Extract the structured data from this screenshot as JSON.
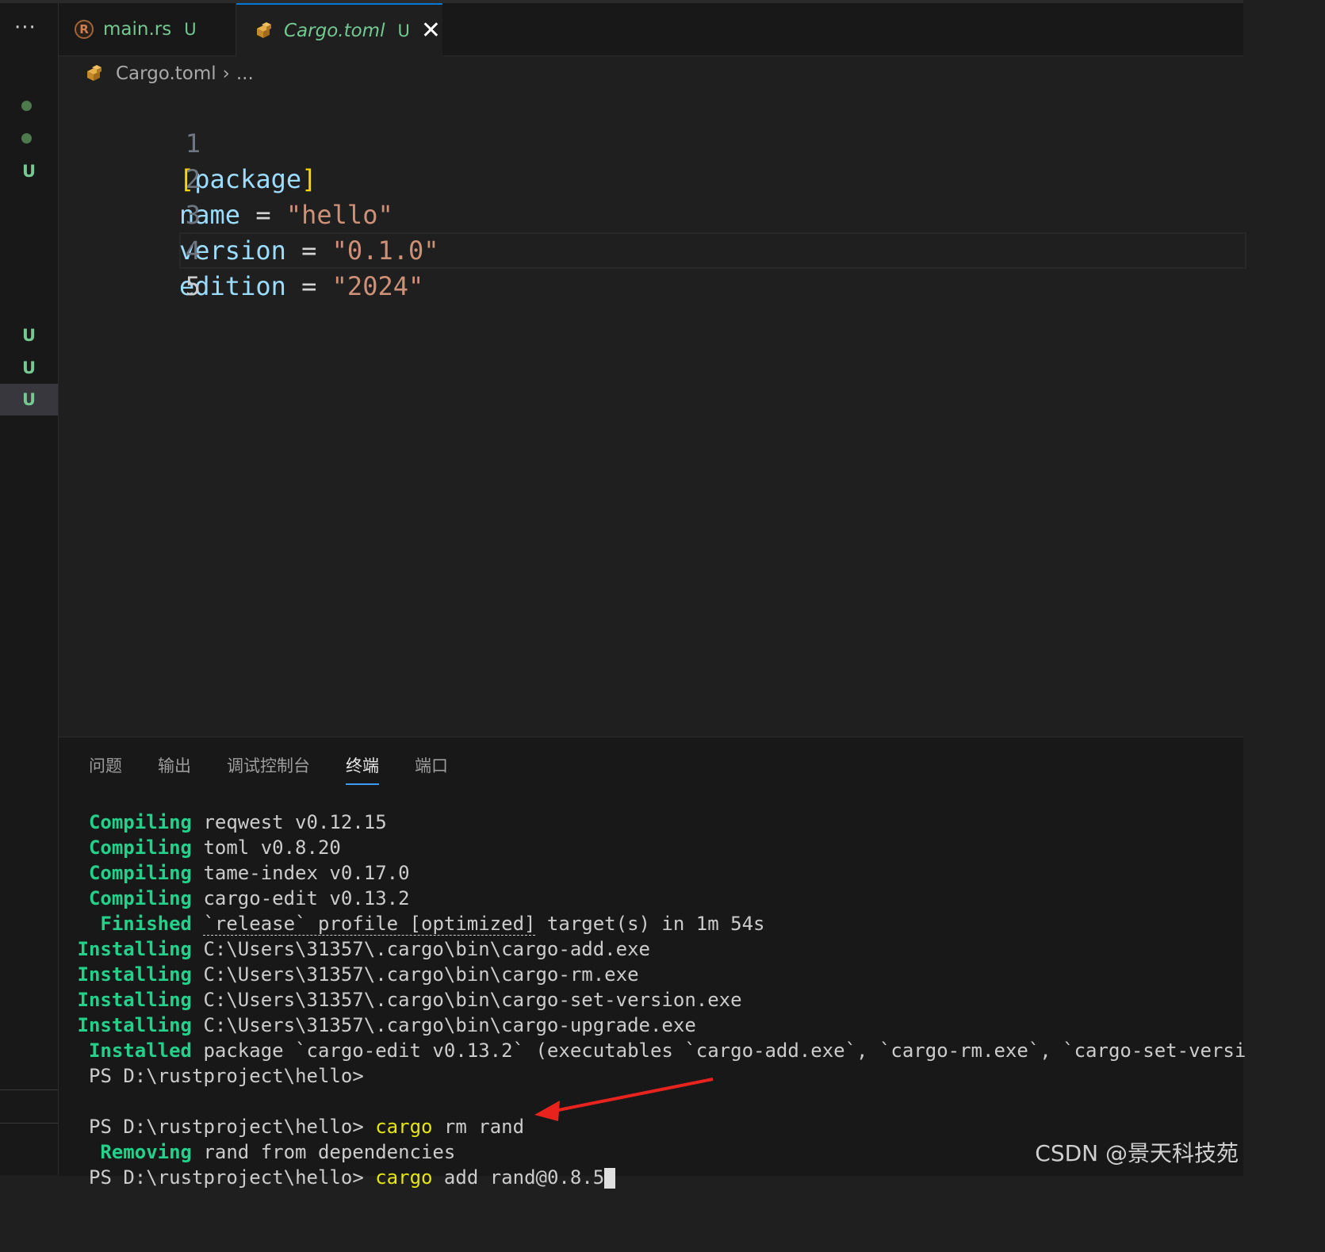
{
  "gutter": {
    "more": "···",
    "badges": [
      "U",
      "U",
      "U",
      "U"
    ]
  },
  "tabs": [
    {
      "label": "main.rs",
      "badge": "U",
      "icon": "rust-file-icon"
    },
    {
      "label": "Cargo.toml",
      "badge": "U",
      "icon": "cargo-package-icon",
      "close": "✕"
    }
  ],
  "breadcrumb": {
    "file": "Cargo.toml",
    "sep": "›",
    "rest": "..."
  },
  "editor": {
    "line_numbers": [
      "1",
      "2",
      "3",
      "4",
      "5"
    ],
    "lines": [
      {
        "open": "[",
        "key": "package",
        "close": "]"
      },
      {
        "key": "name",
        "eq": " = ",
        "value": "\"hello\""
      },
      {
        "key": "version",
        "eq": " = ",
        "value": "\"0.1.0\""
      },
      {
        "key": "edition",
        "eq": " = ",
        "value": "\"2024\""
      }
    ]
  },
  "panel": {
    "tabs": [
      "问题",
      "输出",
      "调试控制台",
      "终端",
      "端口"
    ],
    "active_tab": "终端"
  },
  "terminal": {
    "lines": [
      {
        "label": "Compiling",
        "text": " reqwest v0.12.15"
      },
      {
        "label": "Compiling",
        "text": " toml v0.8.20"
      },
      {
        "label": "Compiling",
        "text": " tame-index v0.17.0"
      },
      {
        "label": "Compiling",
        "text": " cargo-edit v0.13.2"
      },
      {
        "label": "Finished",
        "text_a": " ",
        "text_b": "`release` profile [optimized]",
        "text_c": " target(s) in 1m 54s"
      },
      {
        "label": "Installing",
        "text": " C:\\Users\\31357\\.cargo\\bin\\cargo-add.exe"
      },
      {
        "label": "Installing",
        "text": " C:\\Users\\31357\\.cargo\\bin\\cargo-rm.exe"
      },
      {
        "label": "Installing",
        "text": " C:\\Users\\31357\\.cargo\\bin\\cargo-set-version.exe"
      },
      {
        "label": "Installing",
        "text": " C:\\Users\\31357\\.cargo\\bin\\cargo-upgrade.exe"
      },
      {
        "label": "Installed",
        "text": " package `cargo-edit v0.13.2` (executables `cargo-add.exe`, `cargo-rm.exe`, `cargo-set-versi"
      }
    ],
    "prompt1": "PS D:\\rustproject\\hello>",
    "prompt2": "PS D:\\rustproject\\hello> ",
    "cmd2_cargo": "cargo",
    "cmd2_rest": " rm rand",
    "removing_label": "Removing",
    "removing_text": " rand from dependencies",
    "prompt3": "PS D:\\rustproject\\hello> ",
    "cmd3_cargo": "cargo",
    "cmd3_rest": " add rand@0.8.5"
  },
  "watermark": "CSDN @景天科技苑",
  "colors": {
    "accent": "#0078d4",
    "terminal_green": "#23d18b",
    "annotation_arrow": "#e8231e"
  }
}
